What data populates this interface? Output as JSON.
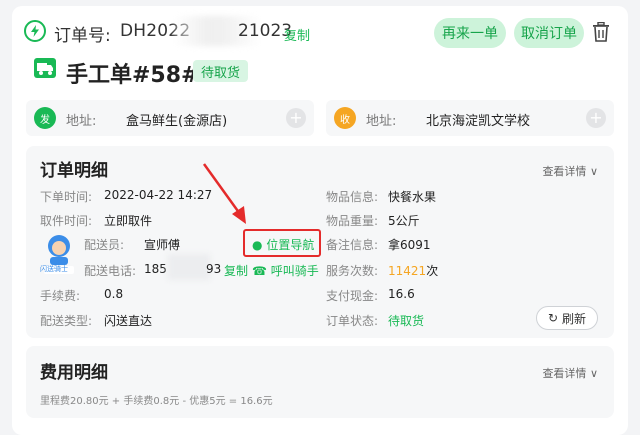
{
  "header": {
    "order_label": "订单号:",
    "order_no_head": "DH2022",
    "order_no_tail": "21023",
    "copy_label": "复制",
    "reorder_label": "再来一单",
    "cancel_label": "取消订单",
    "title": "手工单#58#",
    "status": "待取货"
  },
  "addresses": {
    "from": {
      "badge": "发",
      "label": "地址:",
      "value": "盒马鲜生(金源店)"
    },
    "to": {
      "badge": "收",
      "label": "地址:",
      "value": "北京海淀凯文学校"
    }
  },
  "details": {
    "title": "订单明细",
    "more": "查看详情",
    "left": {
      "order_time_label": "下单时间:",
      "order_time": "2022-04-22 14:27",
      "pickup_time_label": "取件时间:",
      "pickup_time": "立即取件",
      "courier_label": "配送员:",
      "courier": "宣师傅",
      "courier_badge": "闪送骑士",
      "navigate": "位置导航",
      "phone_label": "配送电话:",
      "phone_head": "185",
      "phone_tail": "93",
      "copy": "复制",
      "call": "呼叫骑手",
      "fee_label": "手续费:",
      "fee": "0.8",
      "type_label": "配送类型:",
      "type": "闪送直达"
    },
    "right": {
      "item_label": "物品信息:",
      "item": "快餐水果",
      "weight_label": "物品重量:",
      "weight": "5公斤",
      "remark_label": "备注信息:",
      "remark": "拿6091",
      "service_label": "服务次数:",
      "service_count": "11421",
      "service_unit": "次",
      "cash_label": "支付现金:",
      "cash": "16.6",
      "status_label": "订单状态:",
      "status": "待取货",
      "refresh": "刷新"
    }
  },
  "fees": {
    "title": "费用明细",
    "more": "查看详情",
    "line": "里程费20.80元 + 手续费0.8元 - 优惠5元 = 16.6元"
  },
  "colors": {
    "brand_green": "#19b955",
    "orange_badge": "#f5a623",
    "highlight_red": "#e42b2b"
  }
}
